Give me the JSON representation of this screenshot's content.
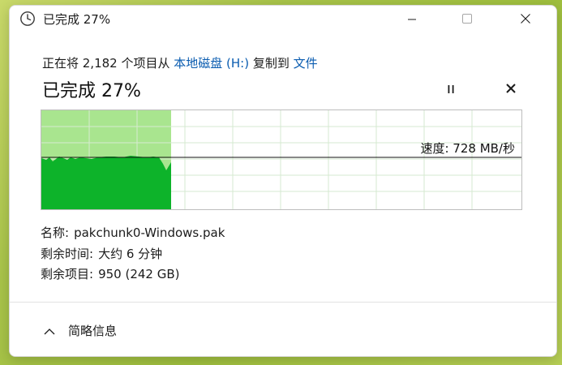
{
  "window": {
    "title": "已完成 27%"
  },
  "icons": {
    "app_icon": "clock-icon",
    "minimize": "minimize-icon",
    "maximize": "maximize-icon",
    "close": "close-icon",
    "pause": "pause-icon",
    "cancel": "cancel-icon",
    "expand": "chevron-up-icon"
  },
  "operation": {
    "prefix": "正在将 2,182 个项目从 ",
    "source": "本地磁盘 (H:)",
    "middle": " 复制到 ",
    "destination": "文件"
  },
  "progress": {
    "status_text": "已完成 27%",
    "percent": 27
  },
  "graph": {
    "speed_text": "速度: 728 MB/秒"
  },
  "details": {
    "name_label": "名称:",
    "name_value": "pakchunk0-Windows.pak",
    "time_label": "剩余时间:",
    "time_value": "大约 6 分钟",
    "items_label": "剩余项目:",
    "items_value": "950 (242 GB)"
  },
  "footer": {
    "toggle_label": "简略信息"
  },
  "colors": {
    "accent_link": "#0a5cb0",
    "graph_fill_dark": "#0db32a",
    "graph_fill_light": "#a9e58f",
    "graph_grid": "#d6ead0"
  }
}
